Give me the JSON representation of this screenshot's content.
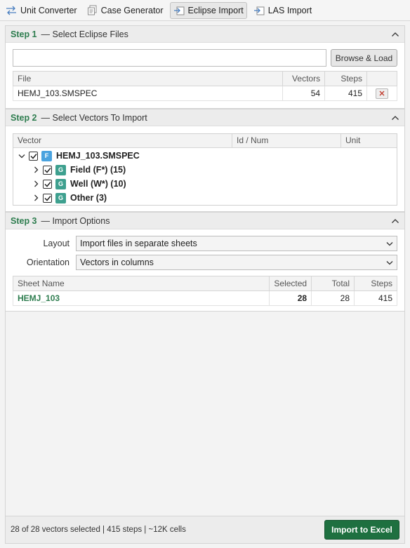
{
  "tabs": [
    {
      "label": "Unit Converter",
      "icon": "arrows-exchange-icon",
      "active": false
    },
    {
      "label": "Case Generator",
      "icon": "copy-pages-icon",
      "active": false
    },
    {
      "label": "Eclipse Import",
      "icon": "import-arrow-icon",
      "active": true
    },
    {
      "label": "LAS Import",
      "icon": "import-arrow-icon",
      "active": false
    }
  ],
  "step1": {
    "number": "Step 1",
    "title": "— Select Eclipse Files",
    "path_value": "",
    "browse_label": "Browse & Load",
    "columns": [
      "File",
      "Vectors",
      "Steps"
    ],
    "files": [
      {
        "file": "HEMJ_103.SMSPEC",
        "vectors": "54",
        "steps": "415"
      }
    ]
  },
  "step2": {
    "number": "Step 2",
    "title": "— Select Vectors To Import",
    "columns": [
      "Vector",
      "Id / Num",
      "Unit"
    ],
    "root": {
      "badge": "F",
      "label": "HEMJ_103.SMSPEC",
      "checked": true
    },
    "groups": [
      {
        "badge": "G",
        "label": "Field (F*) (15)",
        "checked": true
      },
      {
        "badge": "G",
        "label": "Well (W*) (10)",
        "checked": true
      },
      {
        "badge": "G",
        "label": "Other (3)",
        "checked": true
      }
    ]
  },
  "step3": {
    "number": "Step 3",
    "title": "— Import Options",
    "layout_label": "Layout",
    "layout_value": "Import files in separate sheets",
    "orientation_label": "Orientation",
    "orientation_value": "Vectors in columns",
    "columns": [
      "Sheet Name",
      "Selected",
      "Total",
      "Steps"
    ],
    "sheets": [
      {
        "name": "HEMJ_103",
        "selected": "28",
        "total": "28",
        "steps": "415"
      }
    ]
  },
  "status": {
    "text": "28 of 28 vectors selected | 415 steps | ~12K cells",
    "import_label": "Import to Excel"
  },
  "colors": {
    "accent": "#2e7d4f",
    "primary_button": "#1e7040",
    "file_badge": "#4aa3df",
    "group_badge": "#3ea08f"
  }
}
